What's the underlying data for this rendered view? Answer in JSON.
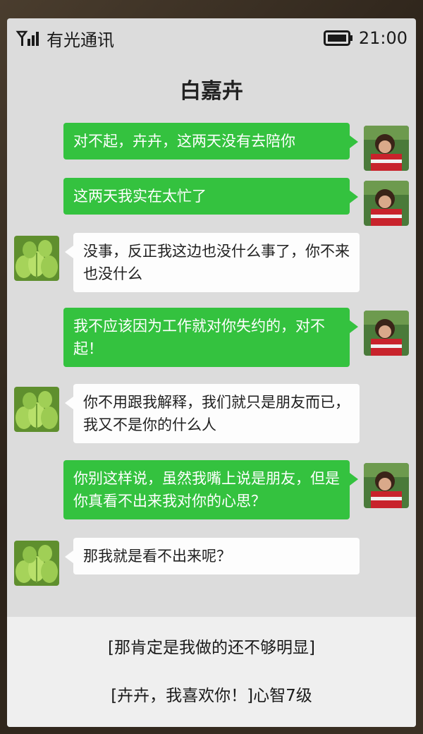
{
  "status": {
    "carrier": "有光通讯",
    "time": "21:00"
  },
  "chat": {
    "contact_name": "白嘉卉"
  },
  "messages": [
    {
      "from": "me",
      "text": "对不起，卉卉，这两天没有去陪你"
    },
    {
      "from": "me",
      "text": "这两天我实在太忙了"
    },
    {
      "from": "them",
      "text": "没事，反正我这边也没什么事了，你不来也没什么"
    },
    {
      "from": "me",
      "text": "我不应该因为工作就对你失约的，对不起！"
    },
    {
      "from": "them",
      "text": "你不用跟我解释，我们就只是朋友而已，我又不是你的什么人"
    },
    {
      "from": "me",
      "text": "你别这样说，虽然我嘴上说是朋友，但是你真看不出来我对你的心思？"
    },
    {
      "from": "them",
      "text": "那我就是看不出来呢？"
    }
  ],
  "choices": [
    {
      "label": "[那肯定是我做的还不够明显]"
    },
    {
      "label": "[卉卉，我喜欢你！]心智7级"
    }
  ],
  "colors": {
    "my_bubble": "#34c23f",
    "their_bubble": "#fdfdfd",
    "screen_bg": "#dcdcdc"
  },
  "icons": {
    "signal": "signal-icon",
    "battery": "battery-icon",
    "my_avatar": "girl-photo-avatar",
    "their_avatar": "succulent-plant-avatar"
  }
}
